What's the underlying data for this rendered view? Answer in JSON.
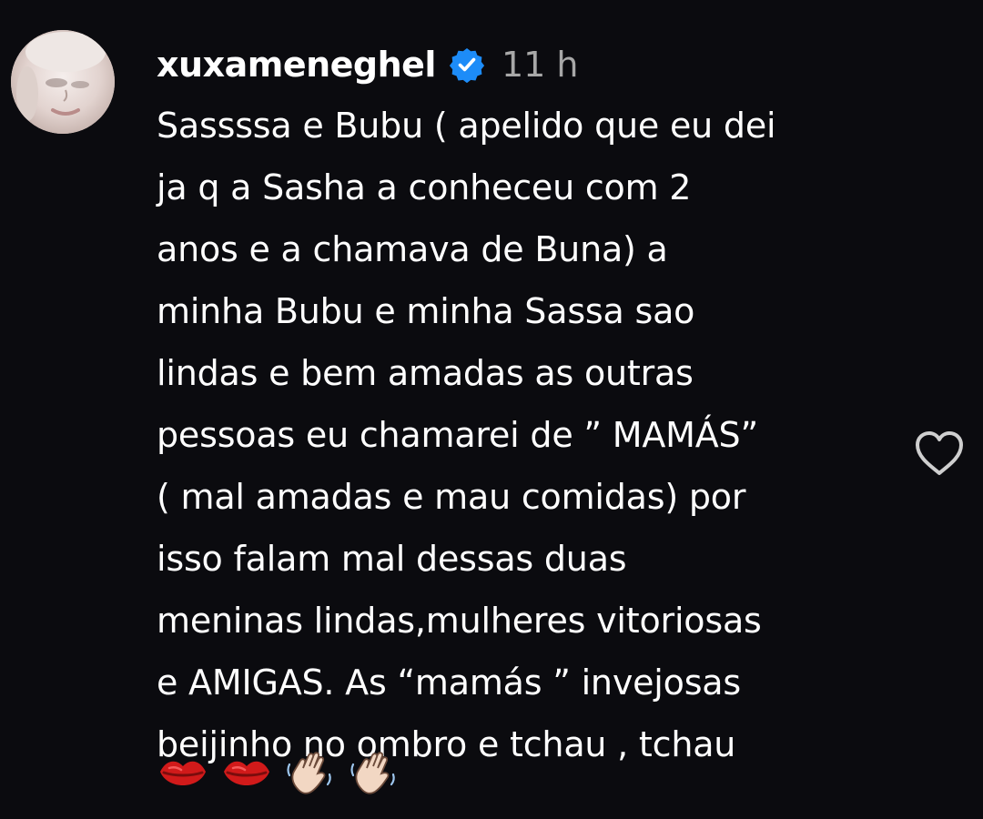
{
  "comment": {
    "username": "xuxameneghel",
    "verified": true,
    "timestamp": "11 h",
    "lines": [
      "Sassssa e Bubu ( apelido que eu dei",
      "ja q a Sasha a conheceu com 2",
      "anos e a chamava de Buna) a",
      "minha Bubu e minha Sassa sao",
      "lindas e bem amadas as outras",
      "pessoas eu chamarei de ” MAMÁS”",
      "( mal amadas e mau comidas) por",
      "isso falam mal dessas duas",
      "meninas lindas,mulheres vitoriosas",
      "e AMIGAS. As “mamás ” invejosas",
      "beijinho no ombro e tchau , tchau"
    ],
    "emojis": [
      "💋",
      "💋",
      "👋🏻",
      "👋🏻"
    ],
    "like_icon": "heart-outline-icon",
    "verified_icon": "verified-badge-icon"
  },
  "colors": {
    "background": "#0b0b0f",
    "text": "#ffffff",
    "muted": "#a8a8a8",
    "verified": "#1d8cf8",
    "lips": "#d11a1a"
  }
}
